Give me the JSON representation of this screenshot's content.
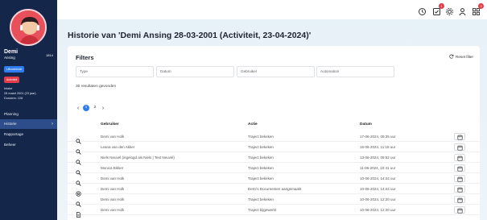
{
  "sidebar": {
    "name": "Demi",
    "surname": "Ansing",
    "code": "1814",
    "badge_a": "Uitvoerende",
    "badge_b": "Activiteit",
    "info": [
      "Intake",
      "28 maart 2001 (23 jaar)",
      "Dossiers: 128"
    ],
    "nav": [
      {
        "label": "Planning"
      },
      {
        "label": "Historie"
      },
      {
        "label": "Rapportage"
      },
      {
        "label": "Beheer"
      }
    ]
  },
  "topbar": {
    "icons": [
      "history-icon",
      "tasks-icon",
      "gear-icon",
      "user-icon",
      "grid-icon"
    ],
    "badges": {
      "tasks": "1",
      "grid": "3"
    }
  },
  "page": {
    "title": "Historie van 'Demi Ansing 28-03-2001 (Activiteit, 23-04-2024)'"
  },
  "filters": {
    "title": "Filters",
    "reset_label": "Reset filter",
    "fields": [
      {
        "placeholder": "Type"
      },
      {
        "placeholder": "Datum"
      },
      {
        "placeholder": "Gebruiker"
      },
      {
        "placeholder": "Automation"
      }
    ]
  },
  "results_text": "30 resultaten gevonden",
  "pagination": {
    "pages": [
      "1",
      "2"
    ],
    "active": "1"
  },
  "table": {
    "headers": {
      "user": "Gebruiker",
      "action": "Actie",
      "date": "Datum"
    },
    "rows": [
      {
        "icon": "search-icon",
        "user": "Demi van Holk",
        "action": "Traject bekeken",
        "date": "17-06-2024, 09:35 uur"
      },
      {
        "icon": "search-icon",
        "user": "Leana van den Akker",
        "action": "Traject bekeken",
        "date": "15-06-2024, 11:18 uur"
      },
      {
        "icon": "search-icon",
        "user": "Niels Neuvel (ingelogd als Niels | Test Neuvel)",
        "action": "Traject bekeken",
        "date": "13-06-2024, 09:52 uur"
      },
      {
        "icon": "search-icon",
        "user": "Monica Bikker",
        "action": "Traject bekeken",
        "date": "11-06-2024, 10:41 uur"
      },
      {
        "icon": "search-icon",
        "user": "Demi van Holk",
        "action": "Traject bekeken",
        "date": "10-06-2024, 14:44 uur"
      },
      {
        "icon": "settings-icon",
        "user": "Demi van Holk",
        "action": "Demi's Documenten aangemaakt",
        "date": "10-06-2024, 14:44 uur"
      },
      {
        "icon": "search-icon",
        "user": "Demi van Holk",
        "action": "Traject bekeken",
        "date": "10-06-2024, 12:20 uur"
      },
      {
        "icon": "document-icon",
        "user": "Demi van Holk",
        "action": "Traject bijgewerkt",
        "date": "10-06-2024, 12:20 uur"
      }
    ]
  }
}
